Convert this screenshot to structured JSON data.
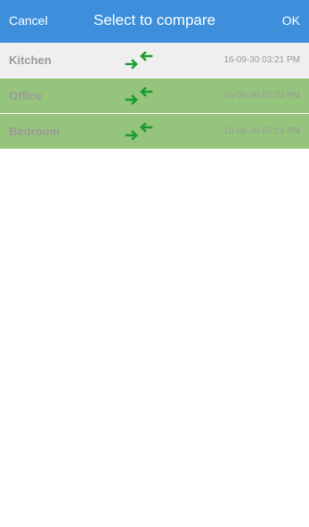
{
  "header": {
    "cancel_label": "Cancel",
    "title": "Select to compare",
    "ok_label": "OK"
  },
  "colors": {
    "header_bg": "#3d8fdb",
    "unselected_row_bg": "#efefef",
    "selected_row_bg": "#95c47c",
    "swap_icon": "#1a9c2e"
  },
  "rows": [
    {
      "name": "Kitchen",
      "time": "16-09-30 03:21 PM",
      "selected": false,
      "icon": "swap-arrows-icon"
    },
    {
      "name": "Office",
      "time": "16-09-30 03:22 PM",
      "selected": true,
      "icon": "swap-arrows-icon"
    },
    {
      "name": "Bedroom",
      "time": "16-09-30 03:23 PM",
      "selected": true,
      "icon": "swap-arrows-icon"
    }
  ]
}
